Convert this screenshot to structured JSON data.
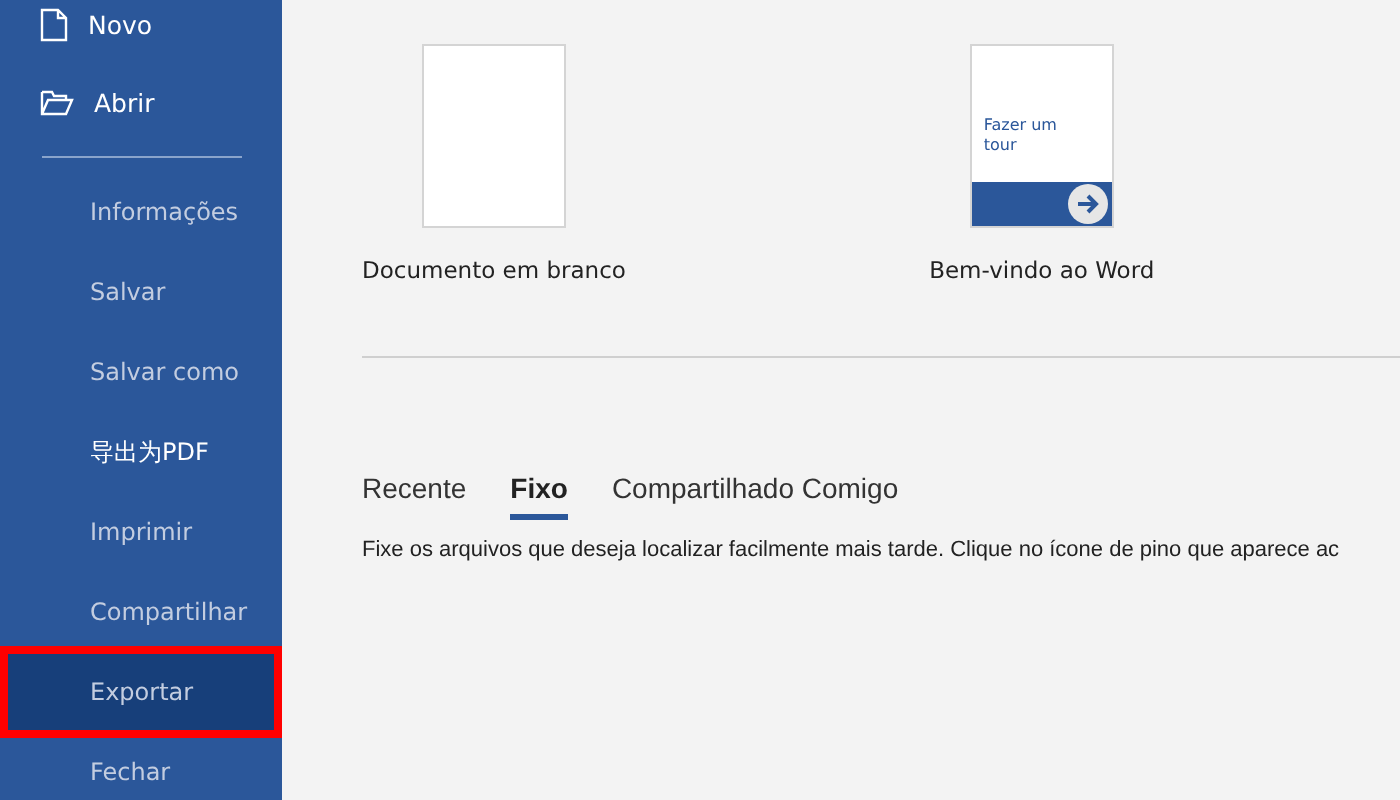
{
  "sidebar": {
    "items": [
      {
        "label": "Novo",
        "kind": "new",
        "dim": false,
        "selected": false,
        "annotated": false
      },
      {
        "label": "Abrir",
        "kind": "open",
        "dim": false,
        "selected": false,
        "annotated": false
      },
      {
        "kind": "divider"
      },
      {
        "label": "Informações",
        "kind": "secondary",
        "dim": true,
        "selected": false,
        "annotated": false
      },
      {
        "label": "Salvar",
        "kind": "secondary",
        "dim": true,
        "selected": false,
        "annotated": false
      },
      {
        "label": "Salvar como",
        "kind": "secondary",
        "dim": true,
        "selected": false,
        "annotated": false
      },
      {
        "label": "导出为PDF",
        "kind": "secondary",
        "dim": false,
        "selected": false,
        "annotated": false
      },
      {
        "label": "Imprimir",
        "kind": "secondary",
        "dim": true,
        "selected": false,
        "annotated": false
      },
      {
        "label": "Compartilhar",
        "kind": "secondary",
        "dim": true,
        "selected": false,
        "annotated": false
      },
      {
        "label": "Exportar",
        "kind": "secondary",
        "dim": true,
        "selected": true,
        "annotated": true
      },
      {
        "label": "Fechar",
        "kind": "secondary",
        "dim": true,
        "selected": false,
        "annotated": false
      }
    ]
  },
  "templates": [
    {
      "kind": "blank",
      "label": "Documento em branco"
    },
    {
      "kind": "tour",
      "label": "Bem-vindo ao Word",
      "thumb_text": "Fazer um tour"
    }
  ],
  "tabs": [
    {
      "label": "Recente",
      "selected": false
    },
    {
      "label": "Fixo",
      "selected": true
    },
    {
      "label": "Compartilhado Comigo",
      "selected": false
    }
  ],
  "description": "Fixe os arquivos que deseja localizar facilmente mais tarde. Clique no ícone de pino que aparece ac"
}
